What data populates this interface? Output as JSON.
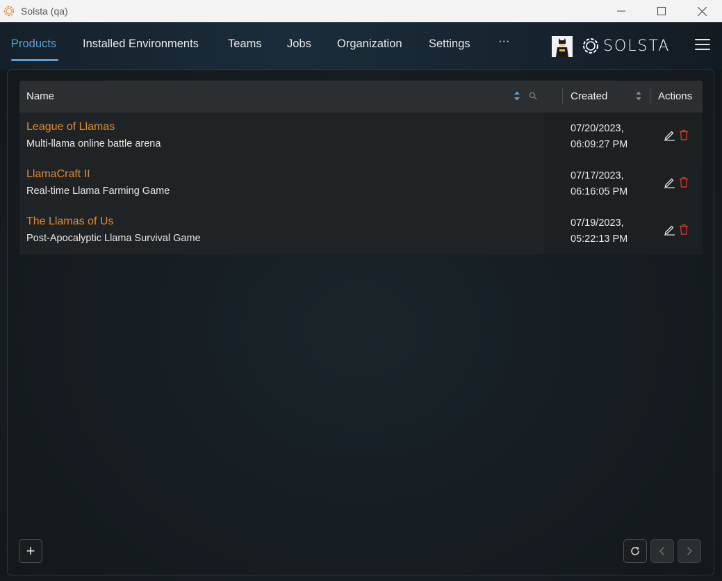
{
  "window": {
    "title": "Solsta (qa)",
    "controls": [
      "minimize-icon",
      "maximize-icon",
      "close-icon"
    ]
  },
  "nav": {
    "tabs": [
      {
        "label": "Products",
        "active": true
      },
      {
        "label": "Installed Environments",
        "active": false
      },
      {
        "label": "Teams",
        "active": false
      },
      {
        "label": "Jobs",
        "active": false
      },
      {
        "label": "Organization",
        "active": false
      },
      {
        "label": "Settings",
        "active": false
      },
      {
        "label": "···",
        "active": false
      }
    ],
    "brand": "SOLSTA",
    "accent": "#5aa0d8"
  },
  "table": {
    "columns": {
      "name": "Name",
      "created": "Created",
      "actions": "Actions"
    },
    "rows": [
      {
        "name": "League of Llamas",
        "description": "Multi-llama online battle arena",
        "created_date": "07/20/2023,",
        "created_time": "06:09:27 PM"
      },
      {
        "name": "LlamaCraft II",
        "description": "Real-time Llama Farming Game",
        "created_date": "07/17/2023,",
        "created_time": "06:16:05 PM"
      },
      {
        "name": "The Llamas of Us",
        "description": "Post-Apocalyptic Llama Survival Game",
        "created_date": "07/19/2023,",
        "created_time": "05:22:13 PM"
      }
    ],
    "name_color": "#e08a2c",
    "delete_color": "#d9342b"
  },
  "footer": {
    "add_label": "+",
    "icons": [
      "refresh-icon",
      "chevron-left-icon",
      "chevron-right-icon"
    ]
  }
}
